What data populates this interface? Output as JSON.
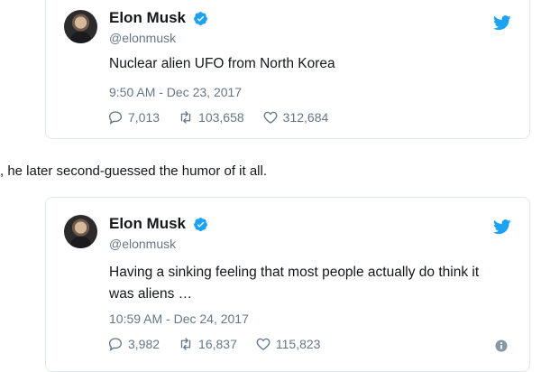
{
  "tweets": [
    {
      "author_name": "Elon Musk",
      "handle": "@elonmusk",
      "text": "Nuclear alien UFO from North Korea",
      "timestamp": "9:50 AM - Dec 23, 2017",
      "replies": "7,013",
      "retweets": "103,658",
      "likes": "312,684"
    },
    {
      "author_name": "Elon Musk",
      "handle": "@elonmusk",
      "text": "Having a sinking feeling that most people actually do think it was aliens …",
      "timestamp": "10:59 AM - Dec 24, 2017",
      "replies": "3,982",
      "retweets": "16,837",
      "likes": "115,823"
    }
  ],
  "article_text": ", he later second-guessed the humor of it all.",
  "colors": {
    "twitter_blue": "#1da1f2",
    "meta_gray": "#657786",
    "border": "#e1e8ed"
  },
  "icons": [
    "verified-badge-icon",
    "twitter-bird-icon",
    "reply-icon",
    "retweet-icon",
    "like-heart-icon",
    "info-icon"
  ]
}
